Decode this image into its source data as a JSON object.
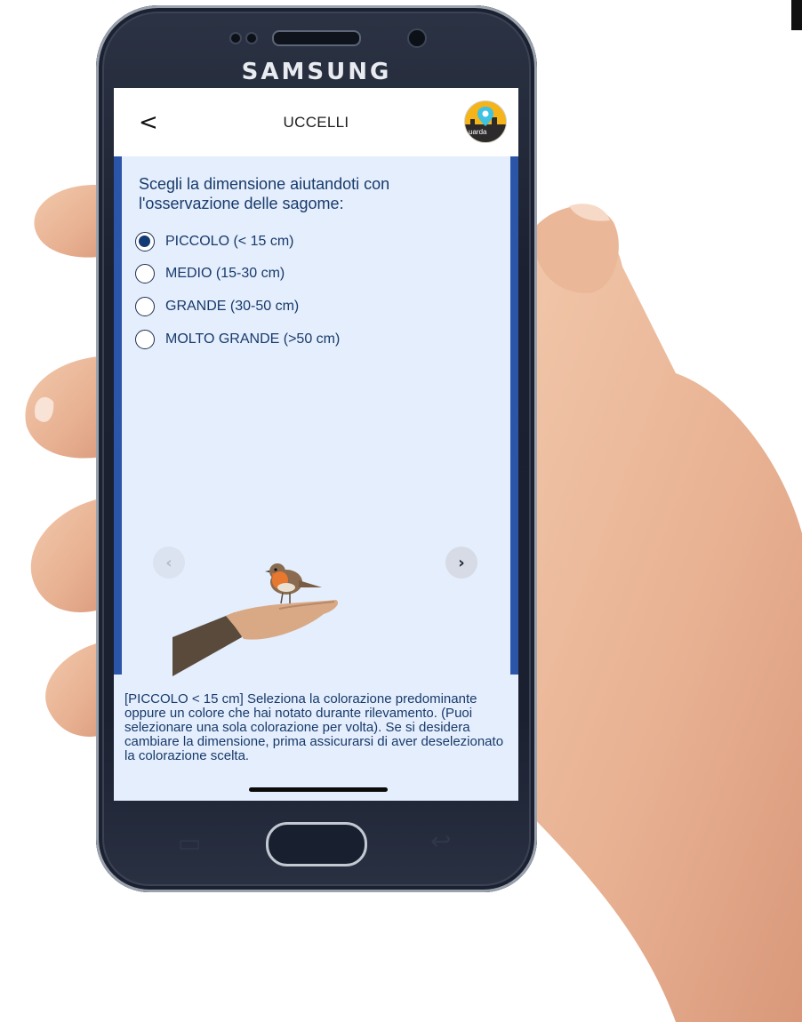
{
  "device": {
    "brand": "SAMSUNG"
  },
  "header": {
    "title": "UCCELLI",
    "logo_text": "uarda"
  },
  "question": "Scegli la dimensione aiutandoti con l'osservazione delle sagome:",
  "size_options": [
    {
      "label": "PICCOLO (< 15 cm)",
      "selected": true
    },
    {
      "label": "MEDIO (15-30 cm)",
      "selected": false
    },
    {
      "label": "GRANDE (30-50 cm)",
      "selected": false
    },
    {
      "label": "MOLTO GRANDE (>50 cm)",
      "selected": false
    }
  ],
  "carousel": {
    "prev_icon": "chevron-left-icon",
    "next_icon": "chevron-right-icon",
    "image": "robin-on-hand-silhouette"
  },
  "description": "[PICCOLO < 15 cm] Seleziona la colorazione predominante oppure un colore che hai notato durante rilevamento. (Puoi selezionare una sola colorazione per volta). Se si desidera cambiare la dimensione, prima assicurarsi di aver deselezionato la colorazione scelta.",
  "colors": {
    "accent": "#2a55a8",
    "text": "#183a6b",
    "background": "#e4eefc"
  }
}
